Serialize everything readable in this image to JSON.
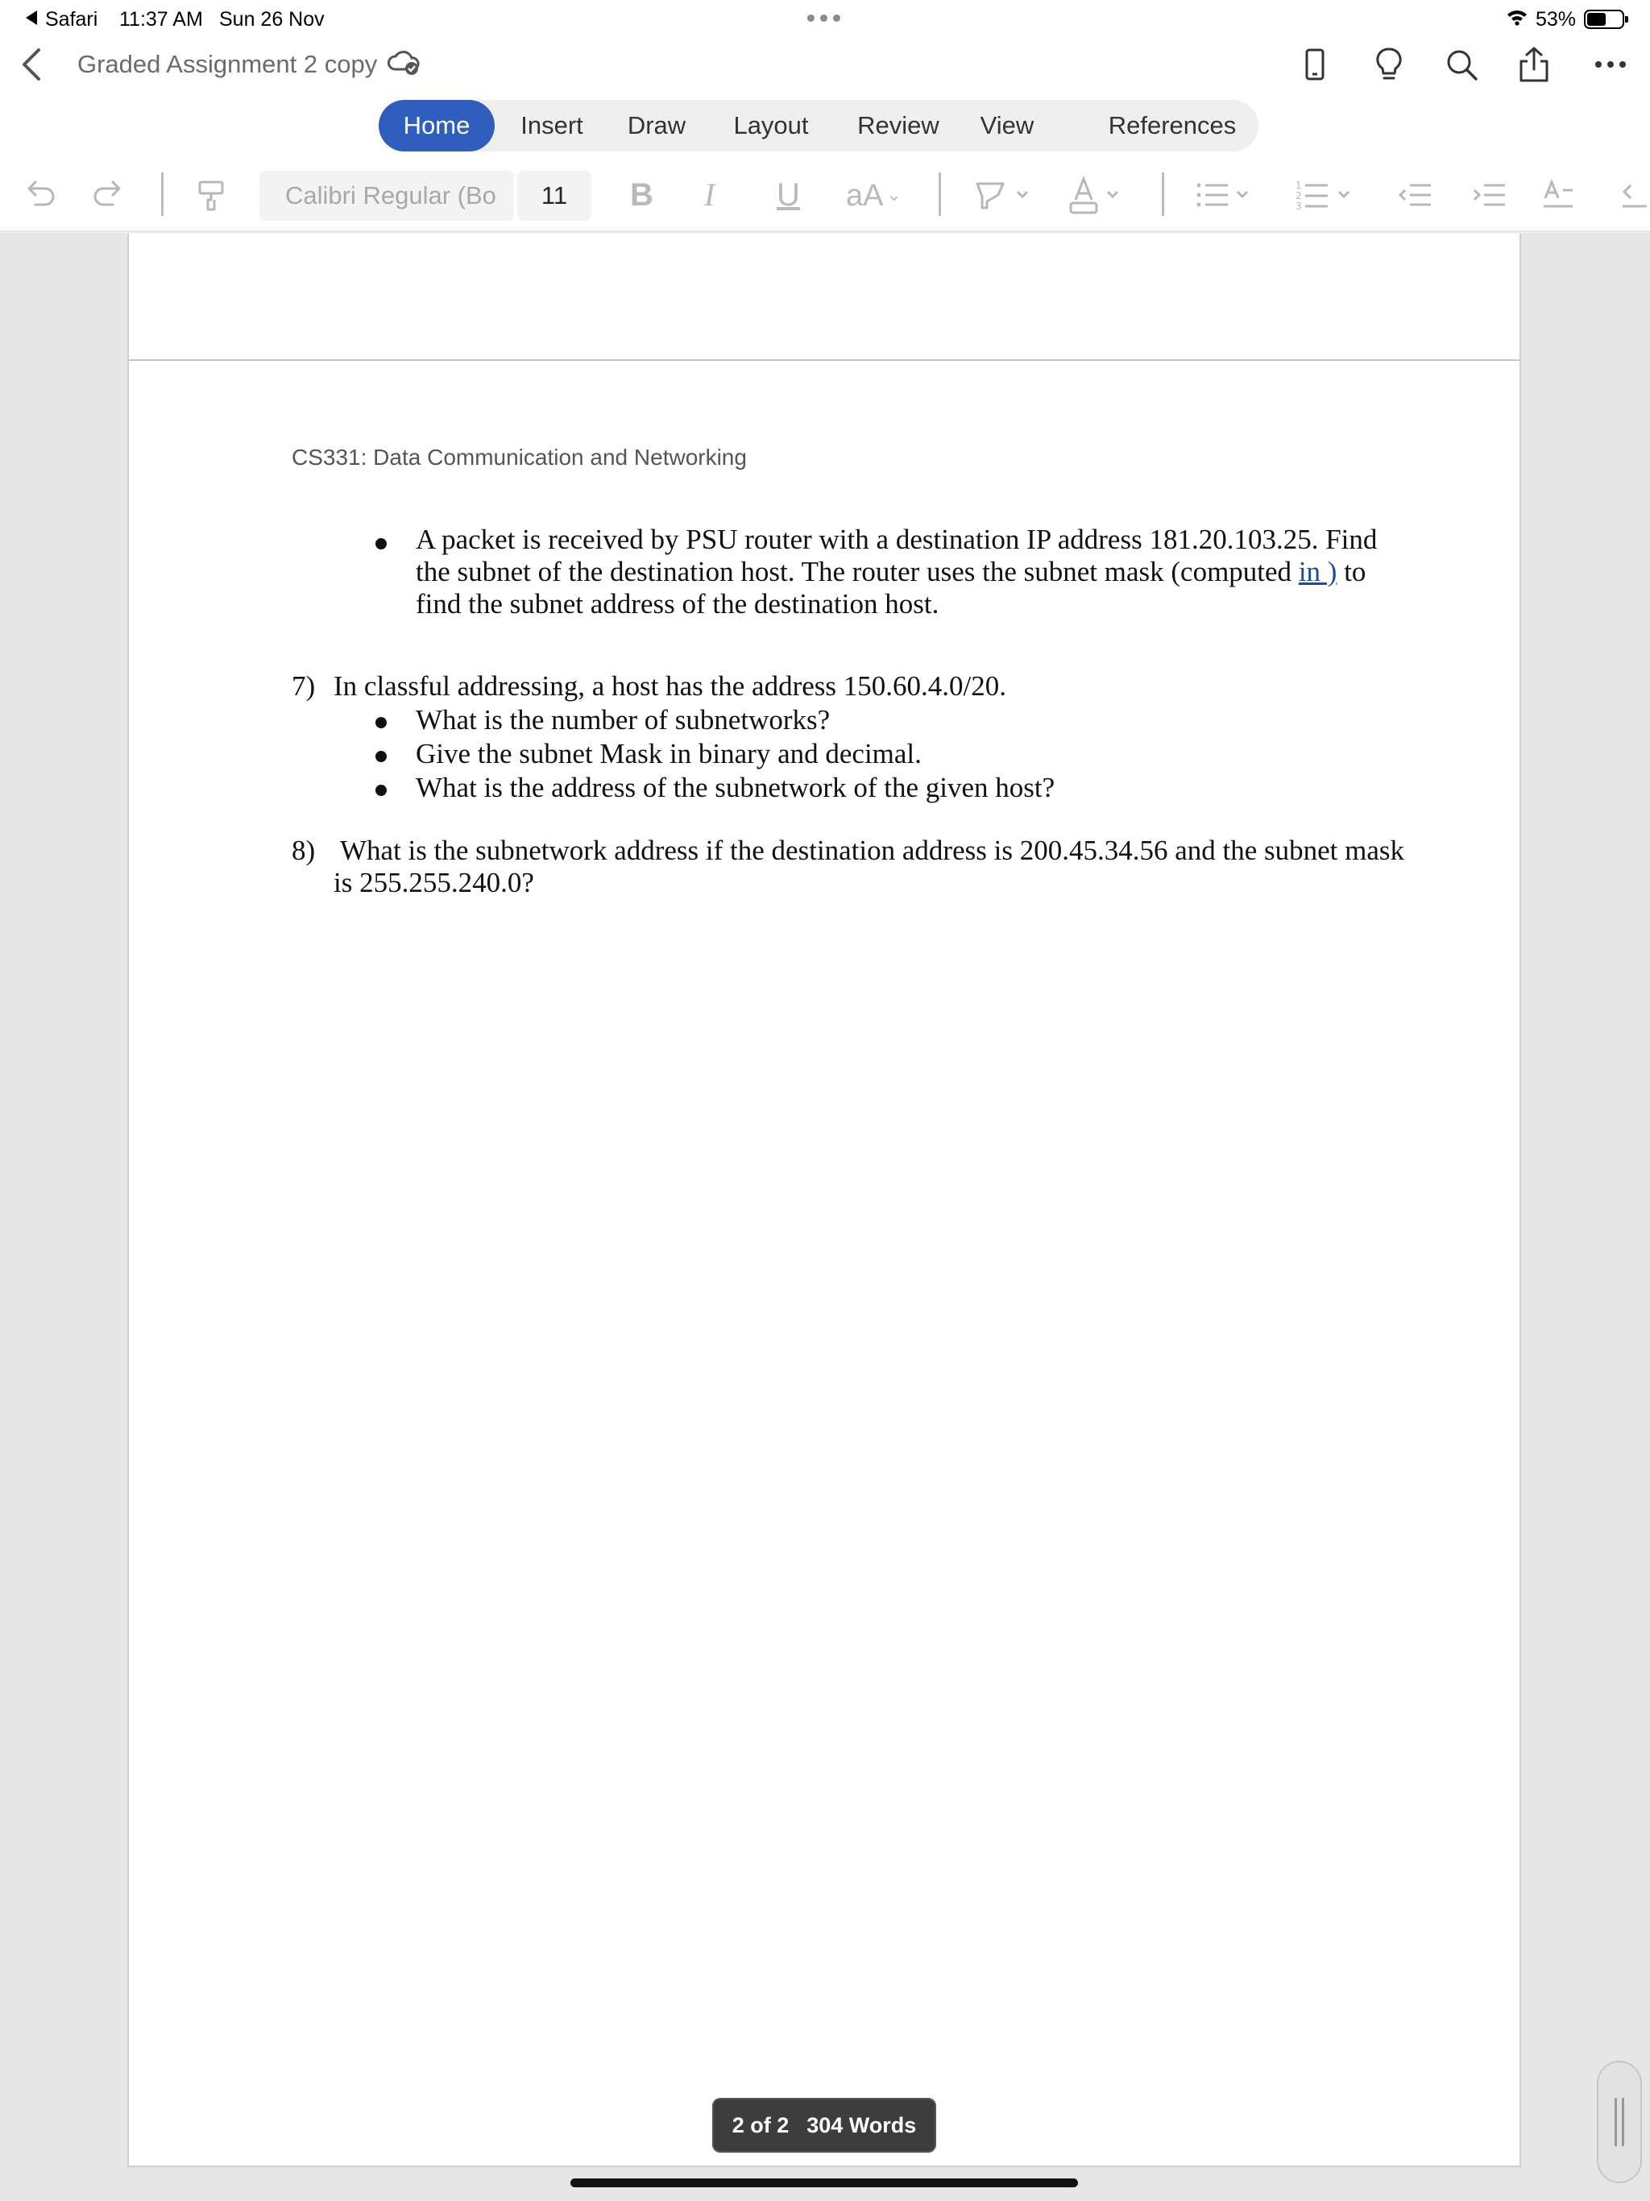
{
  "status_bar": {
    "back_app": "Safari",
    "time": "11:37 AM",
    "date": "Sun 26 Nov",
    "battery": "53%"
  },
  "title_bar": {
    "document_title": "Graded Assignment 2 copy",
    "icons": [
      "chevron-left-icon",
      "cloud-sync-icon",
      "phone-view-icon",
      "lightbulb-icon",
      "search-icon",
      "share-icon",
      "more-icon"
    ]
  },
  "ribbon": {
    "tabs": [
      "Home",
      "Insert",
      "Draw",
      "Layout",
      "Review",
      "View",
      "References"
    ],
    "active_tab": "Home",
    "active_color": "#2f5ebf"
  },
  "toolbar": {
    "font_name": "Calibri Regular (Bo",
    "font_size": "11",
    "bold": "B",
    "italic": "I",
    "underline": "U",
    "case": "aA",
    "icons": [
      "undo-icon",
      "redo-icon",
      "format-painter-icon",
      "highlighter-icon",
      "font-color-icon",
      "bullet-list-icon",
      "numbered-list-icon",
      "decrease-indent-icon",
      "increase-indent-icon",
      "styles-icon"
    ]
  },
  "document": {
    "header": "CS331: Data Communication and Networking",
    "bullet_paragraph": {
      "line1": "A packet is received by PSU router with a destination IP address 181.20.103.25. Find",
      "line2_before": "the subnet of the destination host.  The router uses the subnet mask (computed ",
      "line2_link": "in )",
      "line2_after": " to",
      "line3": "find the subnet address of the destination host."
    },
    "q7": {
      "number": "7)",
      "text": "In classful addressing, a host has the address 150.60.4.0/20.",
      "bullets": [
        "What is the number of subnetworks?",
        "Give the subnet Mask in binary and decimal.",
        "What is the address of the subnetwork of the given host?"
      ]
    },
    "q8": {
      "number": "8)",
      "line1": "What is the subnetwork address if the destination address is 200.45.34.56 and the subnet mask",
      "line2": "is 255.255.240.0?"
    }
  },
  "footer": {
    "page_indicator": "2 of 2",
    "word_count": "304 Words"
  }
}
